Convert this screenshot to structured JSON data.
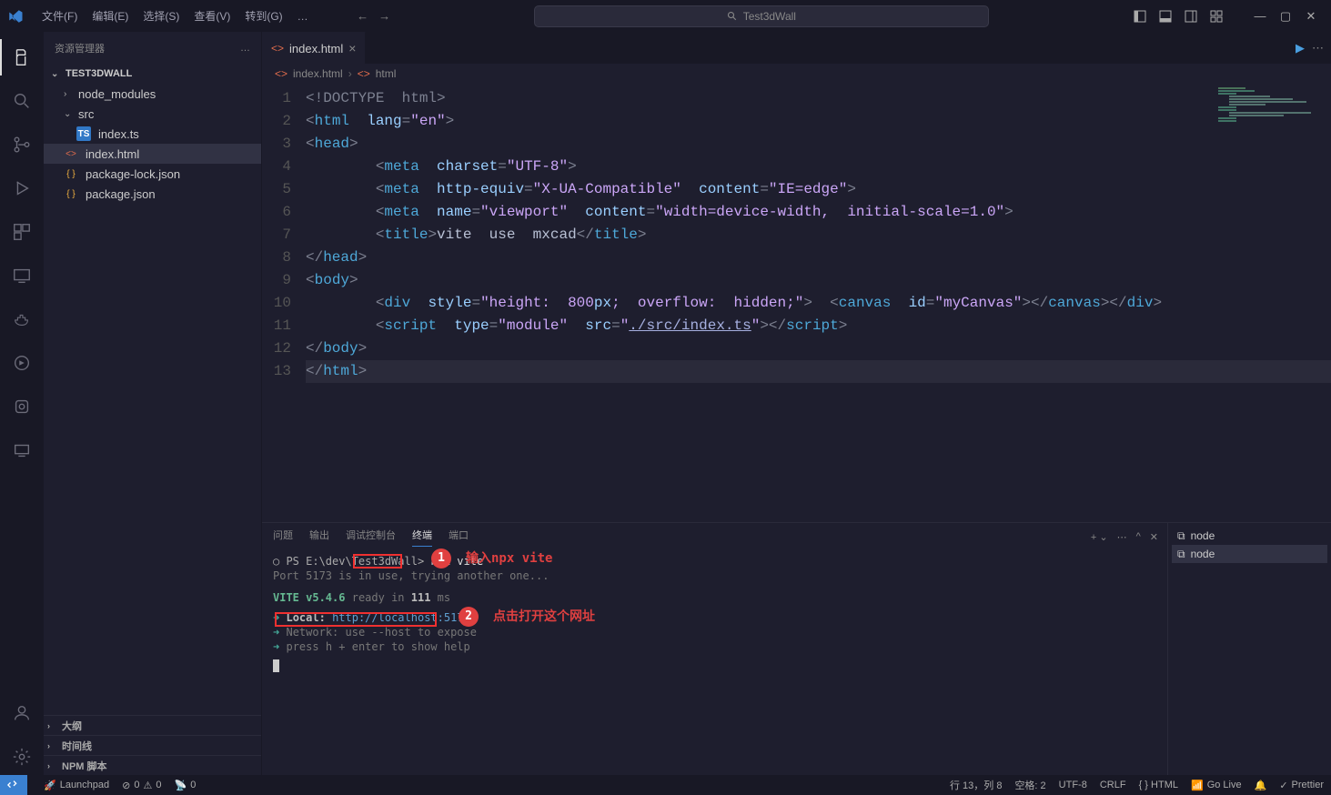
{
  "titlebar": {
    "menus": [
      "文件(F)",
      "编辑(E)",
      "选择(S)",
      "查看(V)",
      "转到(G)",
      "…"
    ],
    "search_text": "Test3dWall"
  },
  "sidebar": {
    "title": "资源管理器",
    "project": "TEST3DWALL",
    "tree": [
      {
        "label": "node_modules",
        "type": "folder",
        "indent": 1,
        "chev": "›"
      },
      {
        "label": "src",
        "type": "folder",
        "indent": 1,
        "chev": "⌄",
        "open": true
      },
      {
        "label": "index.ts",
        "type": "ts",
        "indent": 2
      },
      {
        "label": "index.html",
        "type": "html",
        "indent": 1,
        "selected": true
      },
      {
        "label": "package-lock.json",
        "type": "json",
        "indent": 1
      },
      {
        "label": "package.json",
        "type": "json",
        "indent": 1
      }
    ],
    "sections": [
      "大纲",
      "时间线",
      "NPM 脚本"
    ]
  },
  "tab": {
    "label": "index.html"
  },
  "breadcrumb": {
    "file": "index.html",
    "symbol": "html"
  },
  "code_lines": [
    {
      "n": 1,
      "html": "<span class='c-bracket'>&lt;!</span><span class='c-doctype'>DOCTYPE  html</span><span class='c-bracket'>&gt;</span>"
    },
    {
      "n": 2,
      "html": "<span class='c-bracket'>&lt;</span><span class='c-tag'>html</span>  <span class='c-attr'>lang</span><span class='c-bracket'>=</span><span class='c-str'>\"en\"</span><span class='c-bracket'>&gt;</span>"
    },
    {
      "n": 3,
      "html": "<span class='c-bracket'>&lt;</span><span class='c-tag'>head</span><span class='c-bracket'>&gt;</span>"
    },
    {
      "n": 4,
      "html": "        <span class='c-bracket'>&lt;</span><span class='c-tag'>meta</span>  <span class='c-attr'>charset</span><span class='c-bracket'>=</span><span class='c-str'>\"UTF-8\"</span><span class='c-bracket'>&gt;</span>"
    },
    {
      "n": 5,
      "html": "        <span class='c-bracket'>&lt;</span><span class='c-tag'>meta</span>  <span class='c-attr'>http-equiv</span><span class='c-bracket'>=</span><span class='c-str'>\"X-UA-Compatible\"</span>  <span class='c-attr'>content</span><span class='c-bracket'>=</span><span class='c-str'>\"IE=edge\"</span><span class='c-bracket'>&gt;</span>"
    },
    {
      "n": 6,
      "html": "        <span class='c-bracket'>&lt;</span><span class='c-tag'>meta</span>  <span class='c-attr'>name</span><span class='c-bracket'>=</span><span class='c-str'>\"viewport\"</span>  <span class='c-attr'>content</span><span class='c-bracket'>=</span><span class='c-str'>\"width=device-width,  initial-scale=1.0\"</span><span class='c-bracket'>&gt;</span>"
    },
    {
      "n": 7,
      "html": "        <span class='c-bracket'>&lt;</span><span class='c-tag'>title</span><span class='c-bracket'>&gt;</span><span class='c-text'>vite  use  mxcad</span><span class='c-bracket'>&lt;/</span><span class='c-tag'>title</span><span class='c-bracket'>&gt;</span>"
    },
    {
      "n": 8,
      "html": "<span class='c-bracket'>&lt;/</span><span class='c-tag'>head</span><span class='c-bracket'>&gt;</span>"
    },
    {
      "n": 9,
      "html": "<span class='c-bracket'>&lt;</span><span class='c-tag'>body</span><span class='c-bracket'>&gt;</span>"
    },
    {
      "n": 10,
      "html": "        <span class='c-bracket'>&lt;</span><span class='c-tag'>div</span>  <span class='c-attr'>style</span><span class='c-bracket'>=</span><span class='c-str'>\"height:  800</span><span class='c-attr'>px</span><span class='c-str'>;  overflow:  hidden;\"</span><span class='c-bracket'>&gt;</span>  <span class='c-bracket'>&lt;</span><span class='c-tag'>canvas</span>  <span class='c-attr'>id</span><span class='c-bracket'>=</span><span class='c-str'>\"myCanvas\"</span><span class='c-bracket'>&gt;&lt;/</span><span class='c-tag'>canvas</span><span class='c-bracket'>&gt;&lt;/</span><span class='c-tag'>div</span><span class='c-bracket'>&gt;</span>"
    },
    {
      "n": 11,
      "html": "        <span class='c-bracket'>&lt;</span><span class='c-tag'>script</span>  <span class='c-attr'>type</span><span class='c-bracket'>=</span><span class='c-str'>\"module\"</span>  <span class='c-attr'>src</span><span class='c-bracket'>=</span><span class='c-str'>\"</span><span class='c-link'>./src/index.ts</span><span class='c-str'>\"</span><span class='c-bracket'>&gt;&lt;/</span><span class='c-tag'>script</span><span class='c-bracket'>&gt;</span>"
    },
    {
      "n": 12,
      "html": "<span class='c-bracket'>&lt;/</span><span class='c-tag'>body</span><span class='c-bracket'>&gt;</span>"
    },
    {
      "n": 13,
      "html": "<span class='c-bracket'>&lt;/</span><span class='c-tag'>html</span><span class='c-bracket'>&gt;</span>",
      "hl": true
    }
  ],
  "panel": {
    "tabs": [
      "问题",
      "输出",
      "调试控制台",
      "终端",
      "端口"
    ],
    "active_tab": 3,
    "terminal": {
      "prompt_prefix": "○ PS E:\\dev\\Test3dWall>",
      "command": "npx vite",
      "port_msg": "Port 5173 is in use, trying another one...",
      "vite_version": "VITE v5.4.6",
      "ready": "ready in",
      "ready_ms": "111",
      "ms": "ms",
      "local_label": "Local:",
      "local_url": "http://localhost:5174/",
      "network": "Network: use --host to expose",
      "help": "press h + enter to show help"
    },
    "side": [
      "node",
      "node"
    ],
    "side_active": 1
  },
  "annotations": {
    "a1": {
      "num": "1",
      "text": "输入npx vite"
    },
    "a2": {
      "num": "2",
      "text": "点击打开这个网址"
    }
  },
  "status": {
    "launchpad": "Launchpad",
    "errors": "0",
    "warnings": "0",
    "ports": "0",
    "cursor": "行 13，列 8",
    "spaces": "空格: 2",
    "encoding": "UTF-8",
    "eol": "CRLF",
    "lang": "{ } HTML",
    "golive": "Go Live",
    "prettier": "Prettier"
  }
}
